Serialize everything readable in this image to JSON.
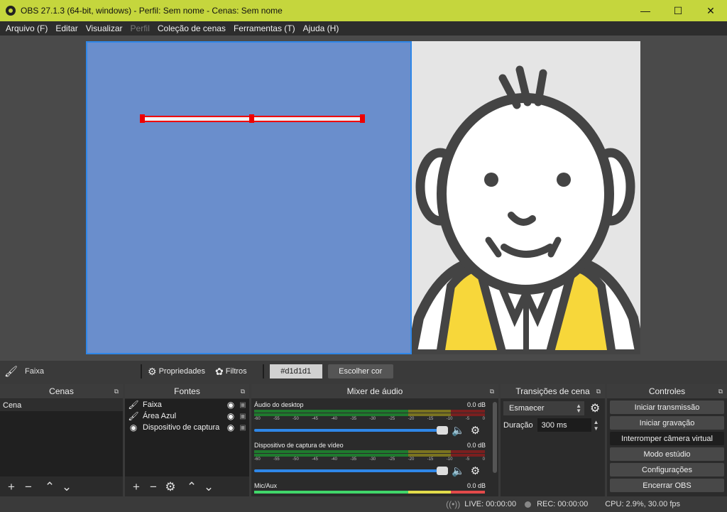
{
  "window": {
    "title": "OBS 27.1.3 (64-bit, windows) - Perfil: Sem nome - Cenas: Sem nome",
    "minimize_icon": "minimize-icon",
    "maximize_icon": "maximize-icon",
    "close_icon": "close-icon"
  },
  "menu": [
    {
      "label": "Arquivo (F)",
      "enabled": true
    },
    {
      "label": "Editar",
      "enabled": true
    },
    {
      "label": "Visualizar",
      "enabled": true
    },
    {
      "label": "Perfil",
      "enabled": false
    },
    {
      "label": "Coleção de cenas",
      "enabled": true
    },
    {
      "label": "Ferramentas (T)",
      "enabled": true
    },
    {
      "label": "Ajuda (H)",
      "enabled": true
    }
  ],
  "context_bar": {
    "source_name": "Faixa",
    "properties_label": "Propriedades",
    "filters_label": "Filtros",
    "color_value": "#d1d1d1",
    "choose_color_label": "Escolher cor"
  },
  "scenes": {
    "title": "Cenas",
    "items": [
      "Cena"
    ]
  },
  "sources": {
    "title": "Fontes",
    "items": [
      {
        "label": "Faixa",
        "icon": "brush-icon"
      },
      {
        "label": "Área Azul",
        "icon": "brush-icon"
      },
      {
        "label": "Dispositivo de captura",
        "icon": "camera-icon"
      }
    ]
  },
  "mixer": {
    "title": "Mixer de áudio",
    "ticks": [
      "-60",
      "-55",
      "-50",
      "-45",
      "-40",
      "-35",
      "-30",
      "-25",
      "-20",
      "-15",
      "-10",
      "-5",
      "0"
    ],
    "channels": [
      {
        "name": "Áudio do desktop",
        "level": "0.0 dB"
      },
      {
        "name": "Dispositivo de captura de vídeo",
        "level": "0.0 dB"
      },
      {
        "name": "Mic/Aux",
        "level": "0.0 dB"
      }
    ]
  },
  "transitions": {
    "title": "Transições de cena",
    "selected": "Esmaecer",
    "duration_label": "Duração",
    "duration_value": "300 ms"
  },
  "controls": {
    "title": "Controles",
    "buttons": [
      "Iniciar transmissão",
      "Iniciar gravação",
      "Interromper câmera virtual",
      "Modo estúdio",
      "Configurações",
      "Encerrar OBS"
    ]
  },
  "status": {
    "live": "LIVE: 00:00:00",
    "rec": "REC: 00:00:00",
    "cpu": "CPU: 2.9%, 30.00 fps"
  },
  "colors": {
    "title_bar": "#c5d63d",
    "canvas_blue": "#6a8ecc",
    "selection": "#ee0000",
    "accent": "#2f87e8"
  }
}
